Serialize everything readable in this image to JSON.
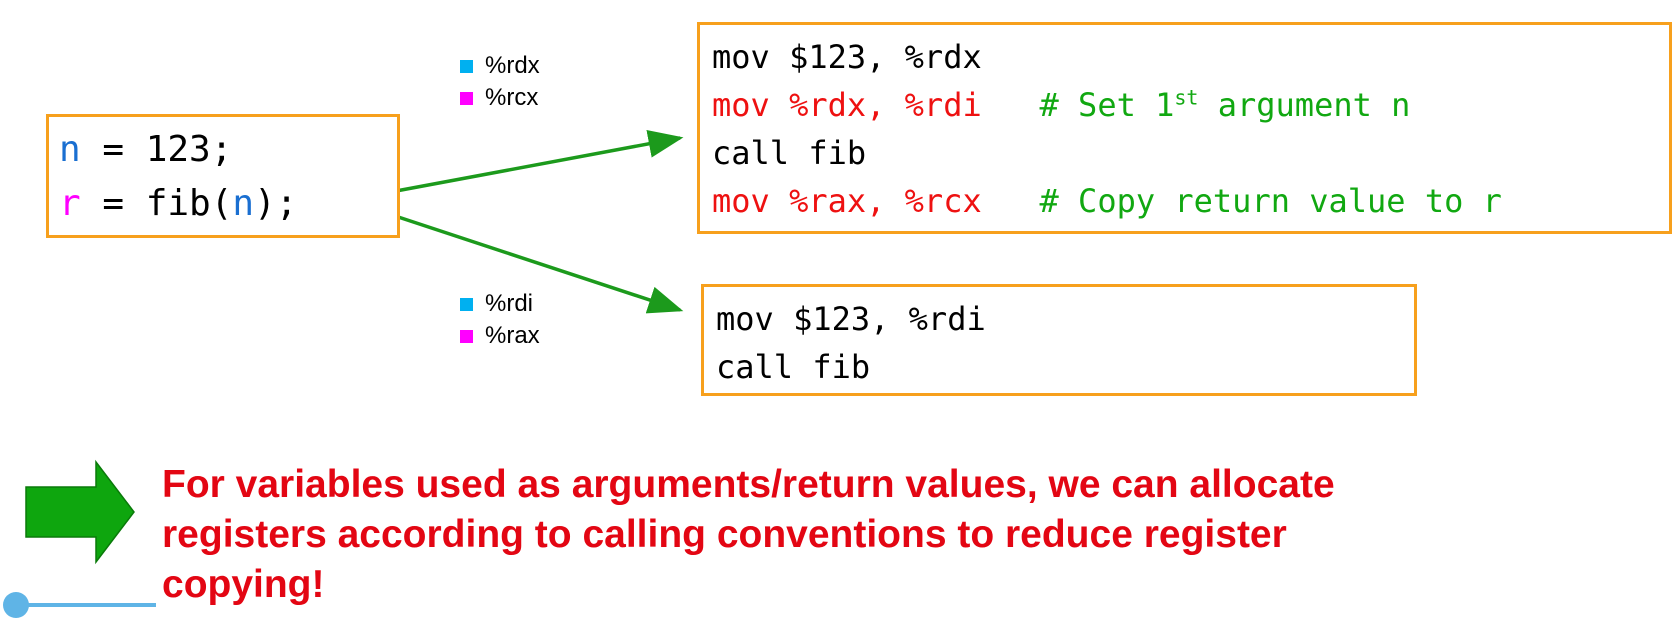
{
  "source": {
    "line1": {
      "var": "n",
      "rest": " = 123;"
    },
    "line2": {
      "var": "r",
      "mid": " = fib(",
      "arg": "n",
      "end": ");"
    }
  },
  "legend_top": {
    "items": [
      {
        "label": "%rdx",
        "color": "#00b0f0"
      },
      {
        "label": "%rcx",
        "color": "#ff00ff"
      }
    ]
  },
  "legend_bottom": {
    "items": [
      {
        "label": "%rdi",
        "color": "#00b0f0"
      },
      {
        "label": "%rax",
        "color": "#ff00ff"
      }
    ]
  },
  "asm_top": {
    "line1": "mov $123, %rdx",
    "line2_code": "mov %rdx, %rdi",
    "line2_comment_pre": "# Set 1",
    "line2_comment_sup": "st",
    "line2_comment_post": " argument n",
    "line3": "call fib",
    "line4_code": "mov %rax, %rcx",
    "line4_comment": "# Copy return value to r"
  },
  "asm_bottom": {
    "line1": "mov $123, %rdi",
    "line2": "call fib"
  },
  "conclusion": {
    "line1": "For variables used as arguments/return values, we can allocate",
    "line2": "registers according to calling conventions to reduce register",
    "line3": "copying!"
  },
  "colors": {
    "box_border": "#f7a01d",
    "arrow_green": "#1c9a1c",
    "conclusion_red": "#e30613",
    "code_red": "#ee1111",
    "comment_green": "#11a811",
    "var_blue": "#1a6fd1",
    "var_magenta": "#ff00ff",
    "timeline_blue": "#5fb4e6"
  }
}
